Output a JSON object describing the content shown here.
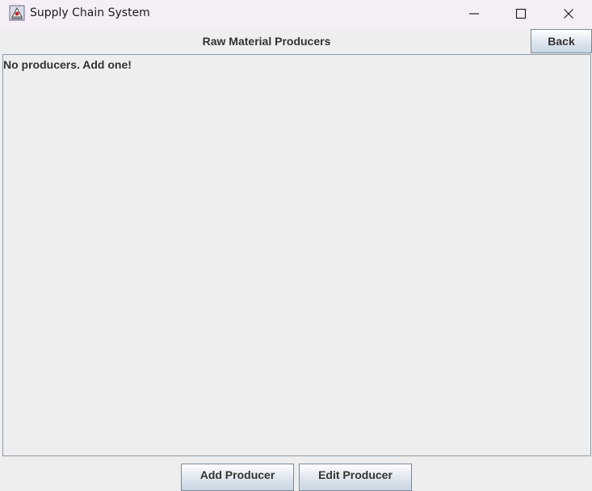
{
  "window": {
    "title": "Supply Chain System"
  },
  "header": {
    "title": "Raw Material Producers",
    "back_label": "Back"
  },
  "content": {
    "empty_message": "No producers. Add one!"
  },
  "actions": {
    "add_label": "Add Producer",
    "edit_label": "Edit Producer"
  },
  "icons": {
    "app": "java-app-icon",
    "minimize": "minimize-icon",
    "maximize": "maximize-icon",
    "close": "close-icon"
  },
  "colors": {
    "titlebar": "#f6eef7",
    "background": "#eeeeee",
    "text": "#333333",
    "button_border": "#7a8a99"
  }
}
